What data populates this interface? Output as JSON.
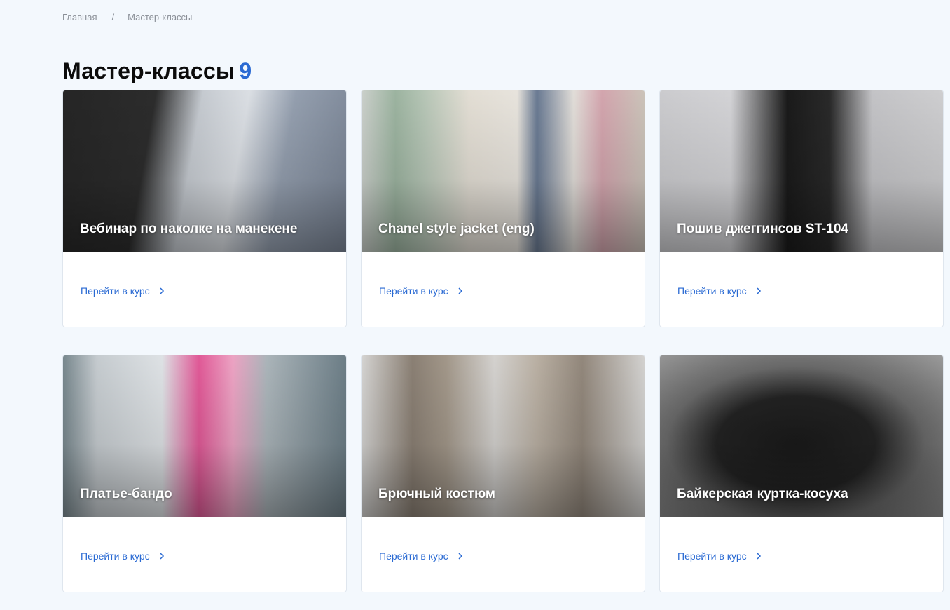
{
  "breadcrumb": {
    "home": "Главная",
    "separator": "/",
    "current": "Мастер-классы"
  },
  "page": {
    "title": "Мастер-классы",
    "count": "9",
    "accent_color": "#2a6ad3"
  },
  "cards": [
    {
      "title": "Вебинар по наколке на манекене",
      "link": "Перейти в курс"
    },
    {
      "title": "Chanel style jacket (eng)",
      "link": "Перейти в курс"
    },
    {
      "title": "Пошив джеггинсов ST-104",
      "link": "Перейти в курс"
    },
    {
      "title": "Платье-бандо",
      "link": "Перейти в курс"
    },
    {
      "title": "Брючный костюм",
      "link": "Перейти в курс"
    },
    {
      "title": "Байкерская куртка-косуха",
      "link": "Перейти в курс"
    }
  ]
}
